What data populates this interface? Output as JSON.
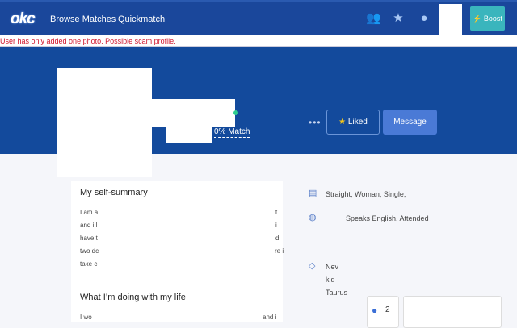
{
  "nav": {
    "logo": "okc",
    "links": [
      "Browse Matches",
      "Quickmatch"
    ],
    "icons": [
      "people-icon",
      "star-icon",
      "chat-icon"
    ],
    "boost": "Boost",
    "boost_color": "#3ab5bd"
  },
  "warning": "User has only added one photo. Possible scam profile.",
  "profile": {
    "match": "0% Match",
    "more": "•••",
    "liked": "Liked",
    "message": "Message"
  },
  "summary": {
    "title": "My self-summary",
    "fragments_left": [
      "I am a",
      "and i l",
      "have t",
      "two dc",
      "take c"
    ],
    "fragments_right": [
      "t",
      "i",
      "d",
      "re i"
    ]
  },
  "life": {
    "title": "What I’m doing with my life",
    "left": "I wo",
    "right": "and i"
  },
  "details": {
    "basics": "Straight, Woman, Single,",
    "background": "Speaks English, Attended",
    "misc": [
      "Nev",
      "kid",
      "Taurus"
    ]
  },
  "chat": {
    "count": "2"
  }
}
